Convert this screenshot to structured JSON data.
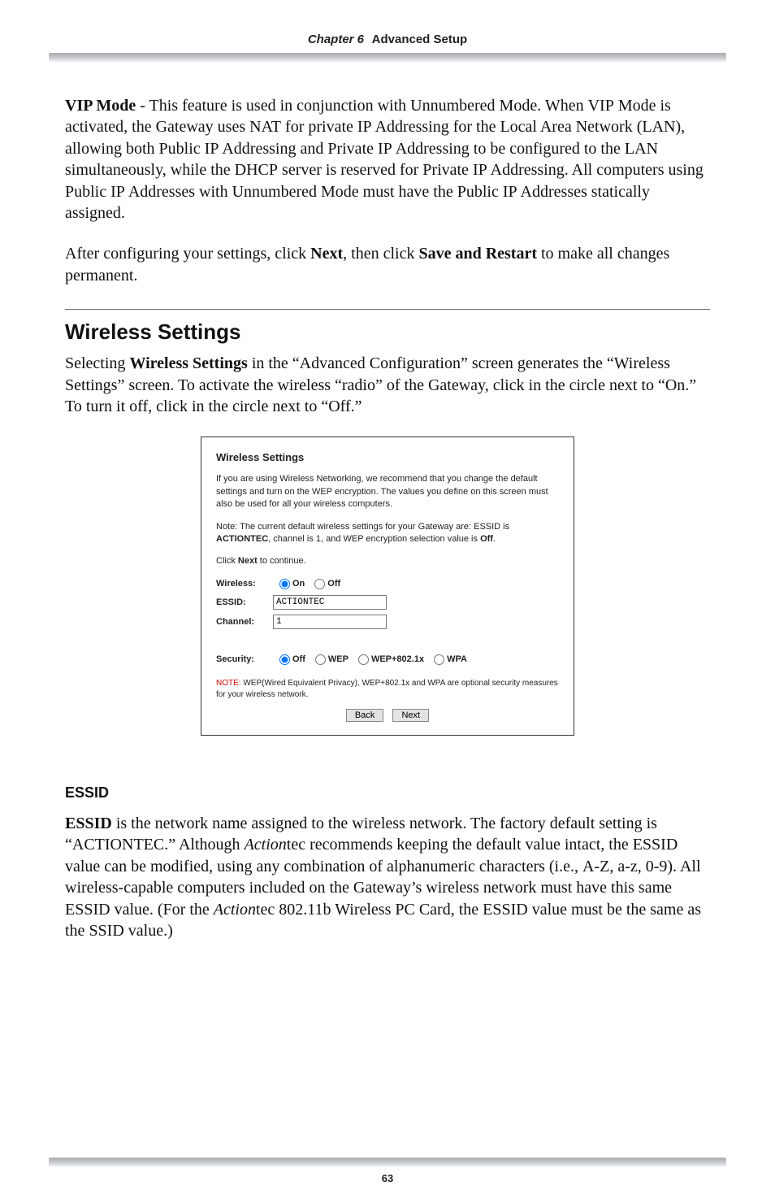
{
  "header": {
    "chapter_label": "Chapter 6",
    "chapter_title": "Advanced Setup"
  },
  "para_vip": "VIP Mode - This feature is used in conjunction with Unnumbered Mode. When VIP Mode is activated, the Gateway uses NAT for private IP Addressing for the Local Area Network (LAN), allowing both Public IP Addressing and Private IP Addressing to be configured to the LAN simultaneously, while the DHCP server is reserved for Private IP Addressing. All computers using Public IP Addresses with Unnumbered Mode must have the Public IP Addresses statically assigned.",
  "para_after_cfg": "After configuring your settings, click Next, then click Save and Restart to make all changes permanent.",
  "section_wireless_title": "Wireless Settings",
  "para_wireless_intro": "Selecting Wireless Settings in the “Advanced Configuration” screen generates the “Wireless Settings” screen. To activate the wireless “radio” of the Gateway, click in the circle next to “On.” To turn it off, click in the circle next to “Off.”",
  "dialog": {
    "title": "Wireless Settings",
    "p1": "If you are using Wireless Networking, we recommend that you change the default settings and turn on the WEP encryption. The values you define on this screen must also be used for all your wireless computers.",
    "p2_a": "Note: The current default wireless settings for your Gateway are: ESSID is ",
    "p2_b_bold": "ACTIONTEC",
    "p2_c": ", channel is 1, and WEP encryption selection value is ",
    "p2_d_bold": "Off",
    "p2_e": ".",
    "p3_a": "Click ",
    "p3_b_bold": "Next",
    "p3_c": " to continue.",
    "label_wireless": "Wireless:",
    "opt_on": "On",
    "opt_off": "Off",
    "label_essid": "ESSID:",
    "essid_value": "ACTIONTEC",
    "label_channel": "Channel:",
    "channel_value": "1",
    "label_security": "Security:",
    "sec_off": "Off",
    "sec_wep": "WEP",
    "sec_wep8021x": "WEP+802.1x",
    "sec_wpa": "WPA",
    "note_red": "NOTE:",
    "note_rest_a": " WEP(Wired Equivalent Privacy), WEP+802.1x and WPA are optional security measures",
    "note_rest_b": "for your wireless network.",
    "btn_back": "Back",
    "btn_next": "Next"
  },
  "subhead_essid": "ESSID",
  "para_essid": "ESSID is the network name assigned to the wireless network. The factory default setting is “ACTIONTEC.” Although Actiontec recommends keeping the default value intact, the ESSID value can be modified, using any combination of alphanumeric characters (i.e., A-Z, a-z, 0-9). All wireless-capable computers included on the Gateway’s wireless network must have this same ESSID value. (For the Actiontec 802.11b Wireless PC Card, the ESSID value must be the same as the SSID value.)",
  "page_number": "63"
}
